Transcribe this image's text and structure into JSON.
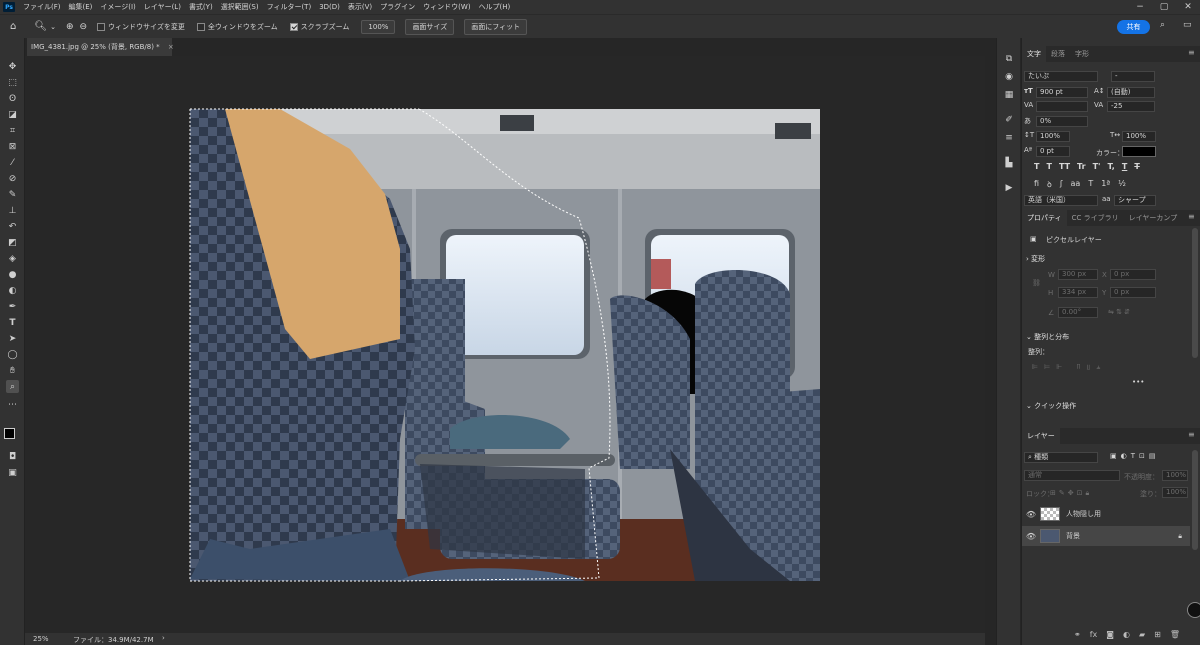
{
  "app": {
    "logo": "Ps"
  },
  "menu": [
    "ファイル(F)",
    "編集(E)",
    "イメージ(I)",
    "レイヤー(L)",
    "書式(Y)",
    "選択範囲(S)",
    "フィルター(T)",
    "3D(D)",
    "表示(V)",
    "プラグイン",
    "ウィンドウ(W)",
    "ヘルプ(H)"
  ],
  "options": {
    "resize_windows": "ウィンドウサイズを変更",
    "zoom_all": "全ウィンドウをズーム",
    "scrubby_zoom": "スクラブズーム",
    "zoom_value": "100%",
    "screen_size": "画面サイズ",
    "fit_screen": "画面にフィット",
    "share": "共有"
  },
  "document": {
    "tab": "IMG_4381.jpg @ 25% (背景, RGB/8) *"
  },
  "status": {
    "zoom": "25%",
    "file": "ファイル：34.9M/42.7M"
  },
  "character": {
    "tabs": [
      "文字",
      "段落",
      "字形"
    ],
    "font": "たいぷ",
    "style": "-",
    "size": "900 pt",
    "leading": "(自動)",
    "kerning": "",
    "tracking": "-25",
    "tsume": "0%",
    "vscale": "100%",
    "hscale": "100%",
    "baseline": "0 pt",
    "color_label": "カラー：",
    "glyphs": [
      "T",
      "T",
      "TT",
      "Tr",
      "T'",
      "T,",
      "T",
      "T"
    ],
    "language": "英語（米国）",
    "antialias_label": "aa",
    "antialias": "シャープ"
  },
  "properties": {
    "tabs": [
      "プロパティ",
      "CC ライブラリ",
      "レイヤーカンプ"
    ],
    "kind": "ピクセルレイヤー",
    "transform_title": "変形",
    "w_label": "W",
    "w": "300 px",
    "x_label": "X",
    "x": "0 px",
    "h_label": "H",
    "h": "334 px",
    "y_label": "Y",
    "y": "0 px",
    "angle": "0.00°",
    "align_title": "整列と分布",
    "align_label": "整列：",
    "quick_title": "クイック操作"
  },
  "layers": {
    "tab": "レイヤー",
    "filter": "種類",
    "blend": "通常",
    "opacity_label": "不透明度：",
    "opacity": "100%",
    "lock_label": "ロック：",
    "fill_label": "塗り：",
    "fill": "100%",
    "items": [
      {
        "name": "人物隠し用",
        "visible": true
      },
      {
        "name": "背景",
        "visible": true,
        "locked": true
      }
    ]
  }
}
